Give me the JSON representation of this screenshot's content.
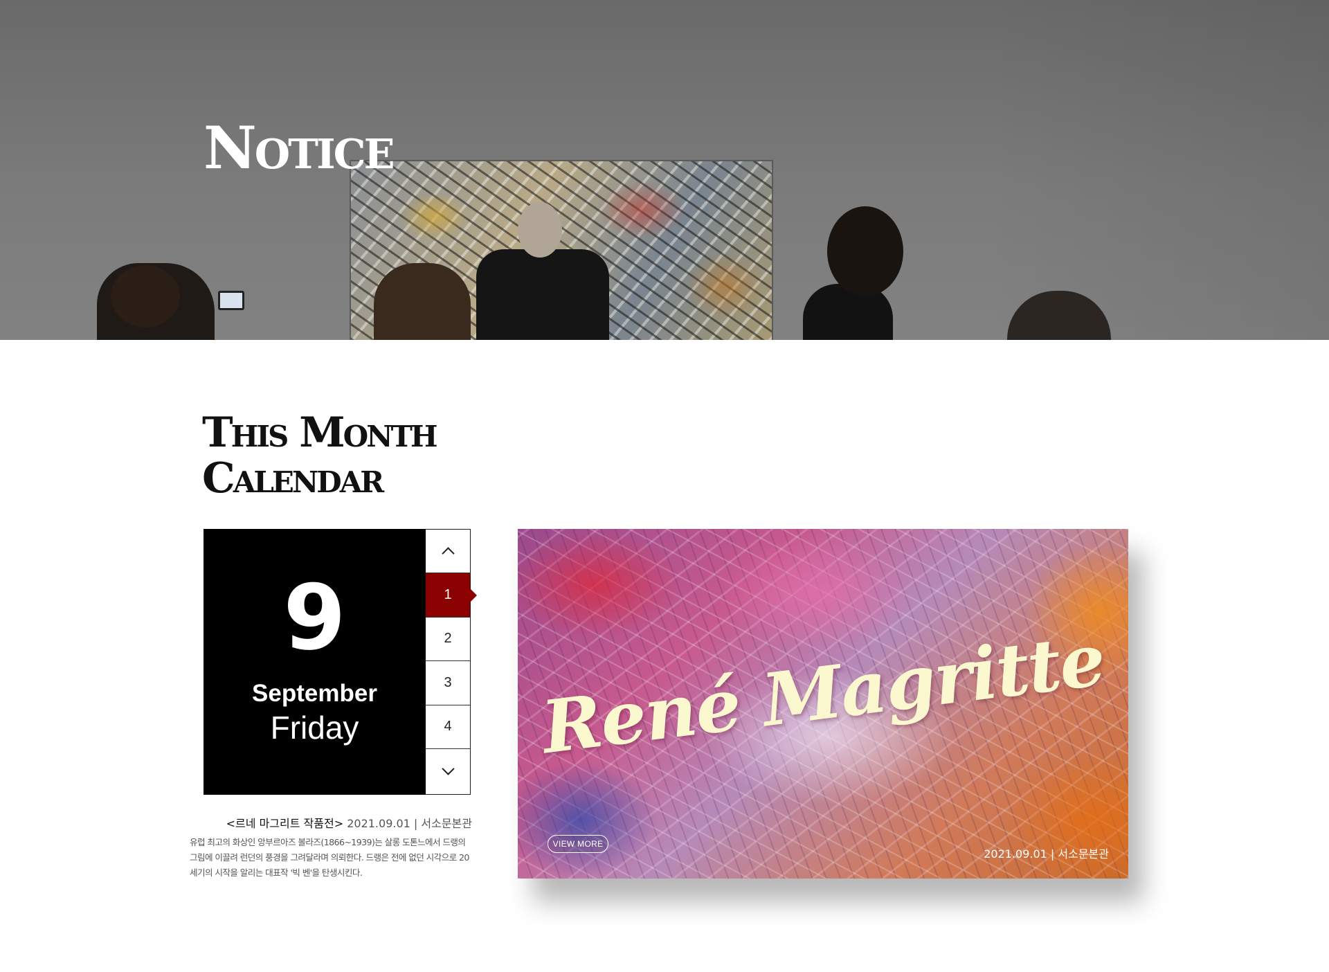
{
  "hero": {
    "title": "Notice"
  },
  "calendar": {
    "section_title_line1": "This Month",
    "section_title_line2": "Calendar",
    "day_number": "9",
    "month": "September",
    "weekday": "Friday",
    "days": [
      "1",
      "2",
      "3",
      "4"
    ],
    "active_day": "1",
    "up_icon": "chevron-up-icon",
    "down_icon": "chevron-down-icon"
  },
  "event": {
    "title": "<르네 마그리트 작품전>",
    "date": "2021.09.01",
    "separator": "|",
    "venue": "서소문본관",
    "description": "유럽 최고의 화상인 앙부르아즈 볼라즈(1866~1939)는 살롱 도톤느에서 드랭의 그림에 이끌려 런던의 풍경을 그려달라며 의뢰한다. 드랭은 전에 없던 시각으로 20세기의 시작을 알리는 대표작 '빅 벤'을 탄생시킨다."
  },
  "feature": {
    "title": "René Magritte",
    "view_more": "VIEW MORE",
    "date": "2021.09.01",
    "separator": "|",
    "venue": "서소문본관"
  },
  "colors": {
    "accent": "#8b0000",
    "date_box": "#000000",
    "feature_title": "#fbf7cf"
  }
}
